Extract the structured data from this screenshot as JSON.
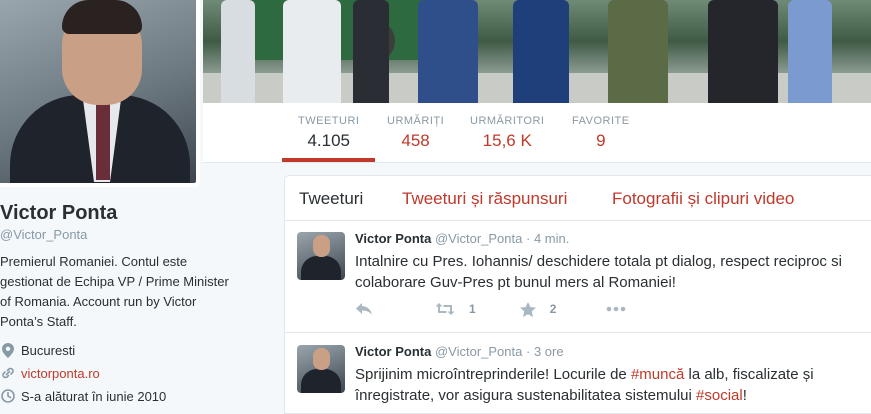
{
  "profile": {
    "name": "Victor Ponta",
    "handle": "@Victor_Ponta",
    "bio": "Premierul Romaniei. Contul este gestionat de Echipa VP / Prime Minister of Romania. Account run by Victor Ponta’s Staff.",
    "location": "Bucuresti",
    "website": "victorponta.ro",
    "joined": "S-a alăturat în iunie 2010"
  },
  "stats": [
    {
      "label": "TWEETURI",
      "value": "4.105"
    },
    {
      "label": "URMĂRIȚI",
      "value": "458"
    },
    {
      "label": "URMĂRITORI",
      "value": "15,6 K"
    },
    {
      "label": "FAVORITE",
      "value": "9"
    }
  ],
  "tabs": [
    "Tweeturi",
    "Tweeturi și răspunsuri",
    "Fotografii și clipuri video"
  ],
  "tweets": [
    {
      "name": "Victor Ponta",
      "handle": "@Victor_Ponta",
      "time": "· 4 min.",
      "text_plain": "Intalnire cu Pres. Iohannis/ deschidere totala pt dialog, respect reciproc si colaborare Guv-Pres pt bunul mers al Romaniei!",
      "retweets": "1",
      "favorites": "2"
    },
    {
      "name": "Victor Ponta",
      "handle": "@Victor_Ponta",
      "time": "· 3 ore",
      "text_a": "Sprijinim microîntreprinderile! Locurile de ",
      "hashtag_1": "#muncă",
      "text_b": " la alb, fiscalizate și înregistrate, vor asigura sustenabilitatea sistemului ",
      "hashtag_2": "#social",
      "text_c": "!"
    }
  ],
  "colors": {
    "accent": "#c0392b",
    "muted": "#8899a6",
    "text": "#292f33",
    "border": "#e1e8ed"
  },
  "icons": [
    "location-pin-icon",
    "link-icon",
    "calendar-icon",
    "reply-icon",
    "retweet-icon",
    "star-icon",
    "more-icon"
  ]
}
